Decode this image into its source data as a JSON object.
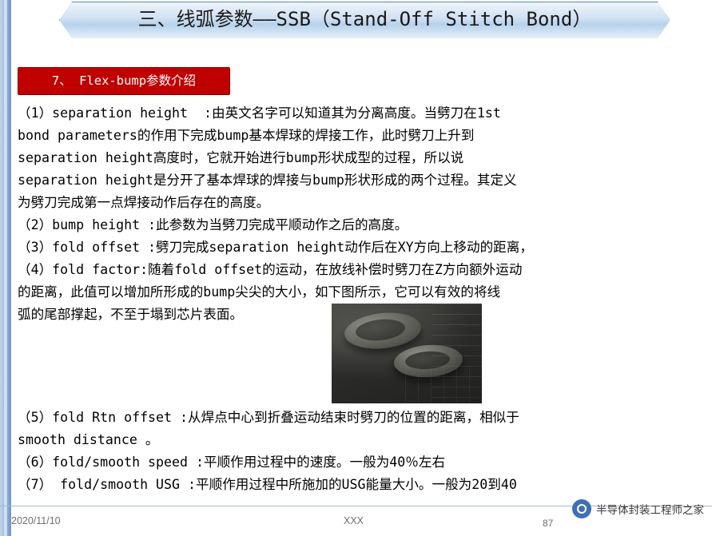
{
  "slide": {
    "title": "三、线弧参数——SSB（Stand-Off  Stitch  Bond）",
    "section_heading": "7、 Flex-bump参数介绍",
    "body_part1": "（1）separation height  :由英文名字可以知道其为分离高度。当劈刀在1st\nbond parameters的作用下完成bump基本焊球的焊接工作，此时劈刀上升到\nseparation height高度时，它就开始进行bump形状成型的过程，所以说\nseparation height是分开了基本焊球的焊接与bump形状形成的两个过程。其定义\n为劈刀完成第一点焊接动作后存在的高度。\n（2）bump height :此参数为当劈刀完成平顺动作之后的高度。\n（3）fold offset :劈刀完成separation height动作后在XY方向上移动的距离，\n（4）fold factor:随着fold offset的运动，在放线补偿时劈刀在Z方向额外运动\n的距离，此值可以增加所形成的bump尖尖的大小，如下图所示，它可以有效的将线\n弧的尾部撑起，不至于塌到芯片表面。",
    "body_part2": "（5）fold Rtn offset :从焊点中心到折叠运动结束时劈刀的位置的距离，相似于\nsmooth distance 。\n（6）fold/smooth speed :平顺作用过程中的速度。一般为40％左右\n（7） fold/smooth USG :平顺作用过程中所施加的USG能量大小。一般为20到40",
    "image_alt": "SEM显微照片：bump焊点形貌"
  },
  "footer": {
    "date": "2020/11/10",
    "center": "XXX",
    "page": "87",
    "watermark": "半导体封装工程师之家"
  },
  "colors": {
    "section_red": "#c00000",
    "banner_blue": "#b7d2ec",
    "left_bar": "#6f95c6"
  }
}
